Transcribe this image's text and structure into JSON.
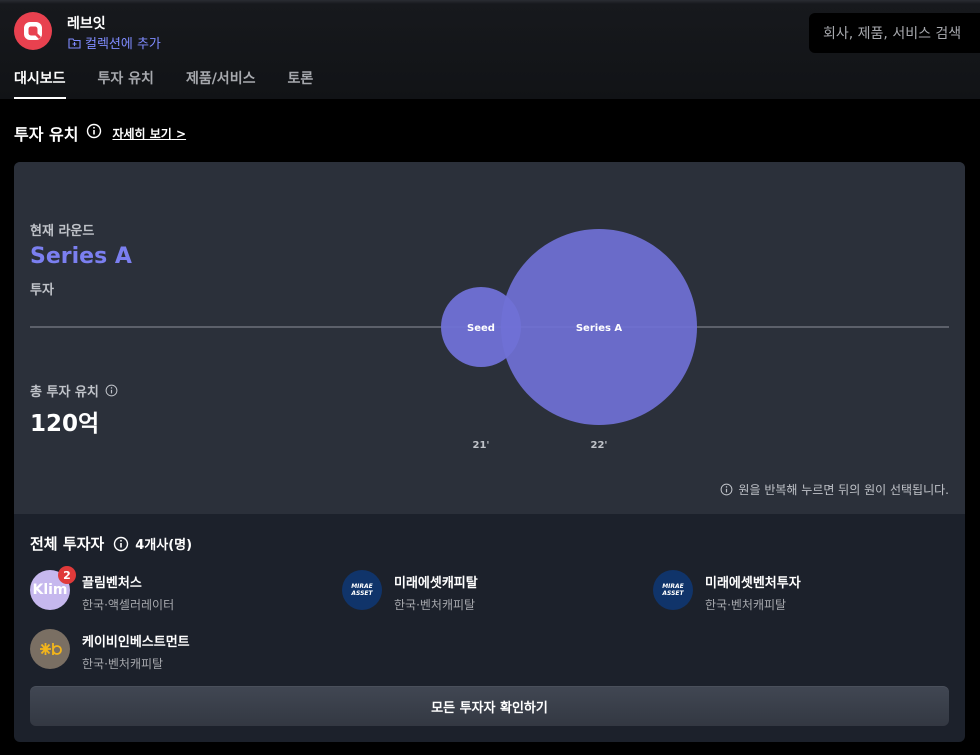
{
  "header": {
    "company_name": "레브잇",
    "collection_link": "컬렉션에 추가",
    "search_placeholder": "회사, 제품, 서비스 검색"
  },
  "tabs": [
    {
      "label": "대시보드",
      "active": true
    },
    {
      "label": "투자 유치",
      "active": false
    },
    {
      "label": "제품/서비스",
      "active": false
    },
    {
      "label": "토론",
      "active": false
    }
  ],
  "funding": {
    "section_title": "투자 유치",
    "detail_link": "자세히 보기",
    "current_round_label": "현재 라운드",
    "current_round": "Series A",
    "round_type": "투자",
    "total_label": "총 투자 유치",
    "total_value": "120억",
    "hint": "원을 반복해 누르면 뒤의 원이 선택됩니다."
  },
  "chart_data": {
    "type": "bubble",
    "points": [
      {
        "label": "Seed",
        "year": "21'"
      },
      {
        "label": "Series A",
        "year": "22'"
      }
    ]
  },
  "investors": {
    "title": "전체 투자자",
    "count": "4개사(명)",
    "items": [
      {
        "name": "끌림벤처스",
        "desc": "한국·액셀러레이터",
        "badge": "2",
        "logo_text": "Klim"
      },
      {
        "name": "미래에셋캐피탈",
        "desc": "한국·벤처캐피탈",
        "logo_text": "MIRAE ASSET"
      },
      {
        "name": "미래에셋벤처투자",
        "desc": "한국·벤처캐피탈",
        "logo_text": "MIRAE ASSET"
      },
      {
        "name": "케이비인베스트먼트",
        "desc": "한국·벤처캐피탈"
      }
    ],
    "all_button": "모든 투자자 확인하기"
  },
  "colors": {
    "accent": "#7b7ff0",
    "bubble": "#7071d6",
    "logo_red": "#e8414f"
  }
}
